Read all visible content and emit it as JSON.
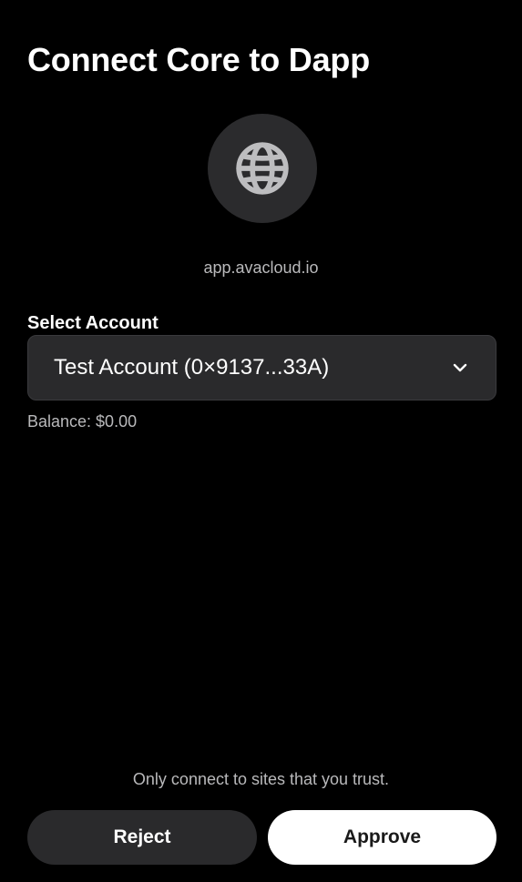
{
  "header": {
    "title": "Connect Core to Dapp"
  },
  "site": {
    "icon": "globe-icon",
    "domain": "app.avacloud.io"
  },
  "account": {
    "label": "Select Account",
    "selected": "Test Account (0×9137...33A)",
    "balance": "Balance: $0.00",
    "chevron_icon": "chevron-down-icon"
  },
  "footer": {
    "note": "Only connect to sites that you trust.",
    "reject_label": "Reject",
    "approve_label": "Approve"
  },
  "colors": {
    "background": "#000000",
    "surface": "#2a2a2c",
    "avatar_bg": "#2b2b2d",
    "muted_text": "#b9b9bb",
    "primary_button": "#ffffff"
  }
}
